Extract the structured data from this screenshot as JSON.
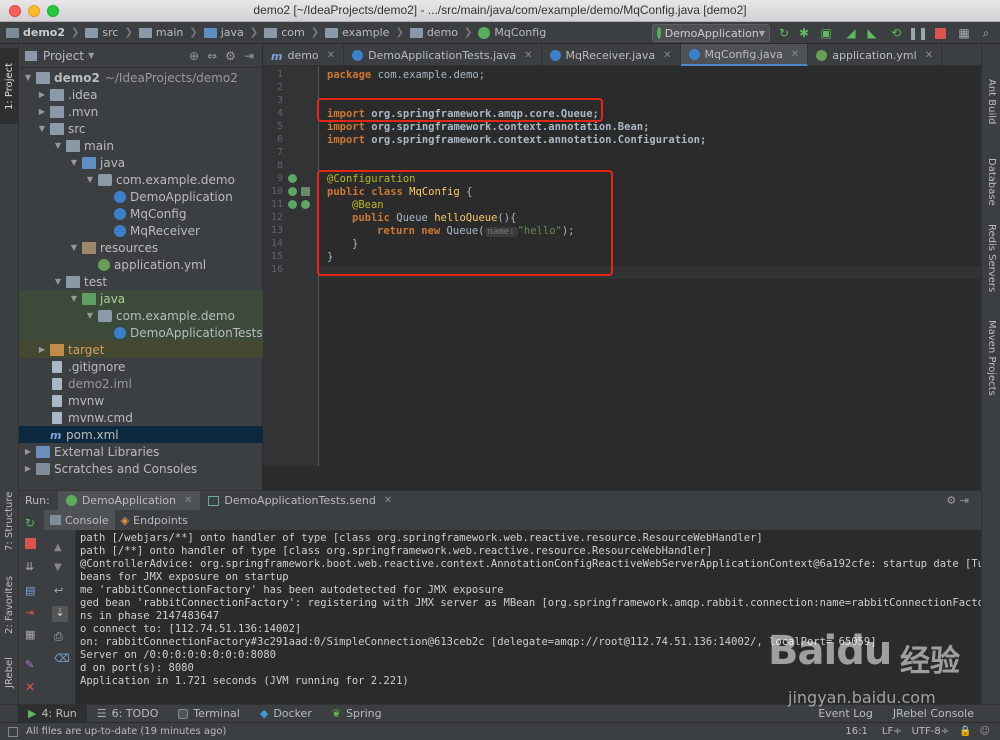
{
  "window": {
    "title": "demo2 [~/IdeaProjects/demo2] - .../src/main/java/com/example/demo/MqConfig.java [demo2]"
  },
  "navbar": {
    "breadcrumbs": [
      "demo2",
      "src",
      "main",
      "java",
      "com",
      "example",
      "demo",
      "MqConfig"
    ],
    "run_config": "DemoApplication"
  },
  "left_strip": {
    "tabs": [
      "1: Project",
      "7: Structure",
      "2: Favorites",
      "JRebel"
    ]
  },
  "right_strip": {
    "tabs": [
      "Ant Build",
      "Database",
      "Redis Servers",
      "Maven Projects"
    ]
  },
  "project": {
    "title": "Project",
    "tree": [
      {
        "label": "demo2",
        "suffix": "~/IdeaProjects/demo2",
        "icon": "folder-icon"
      },
      {
        "label": ".idea",
        "icon": "folder-icon"
      },
      {
        "label": ".mvn",
        "icon": "folder-icon"
      },
      {
        "label": "src",
        "icon": "folder-icon"
      },
      {
        "label": "main",
        "icon": "folder-icon"
      },
      {
        "label": "java",
        "icon": "source-folder-icon"
      },
      {
        "label": "com.example.demo",
        "icon": "package-icon"
      },
      {
        "label": "DemoApplication",
        "icon": "class-icon"
      },
      {
        "label": "MqConfig",
        "icon": "class-icon"
      },
      {
        "label": "MqReceiver",
        "icon": "class-icon"
      },
      {
        "label": "resources",
        "icon": "resources-folder-icon"
      },
      {
        "label": "application.yml",
        "icon": "yml-file-icon"
      },
      {
        "label": "test",
        "icon": "folder-icon"
      },
      {
        "label": "java",
        "icon": "test-folder-icon"
      },
      {
        "label": "com.example.demo",
        "icon": "package-icon"
      },
      {
        "label": "DemoApplicationTests",
        "icon": "class-icon"
      },
      {
        "label": "target",
        "icon": "excluded-folder-icon"
      },
      {
        "label": ".gitignore",
        "icon": "file-icon"
      },
      {
        "label": "demo2.iml",
        "icon": "file-icon"
      },
      {
        "label": "mvnw",
        "icon": "file-icon"
      },
      {
        "label": "mvnw.cmd",
        "icon": "file-icon"
      },
      {
        "label": "pom.xml",
        "icon": "maven-icon"
      },
      {
        "label": "External Libraries",
        "icon": "library-icon"
      },
      {
        "label": "Scratches and Consoles",
        "icon": "scratch-icon"
      }
    ]
  },
  "editor": {
    "tabs": [
      {
        "label": "demo",
        "icon": "maven-icon"
      },
      {
        "label": "DemoApplicationTests.java",
        "icon": "class-icon"
      },
      {
        "label": "MqReceiver.java",
        "icon": "class-icon"
      },
      {
        "label": "MqConfig.java",
        "icon": "class-icon",
        "active": true
      },
      {
        "label": "application.yml",
        "icon": "yml-file-icon"
      }
    ],
    "line_numbers": [
      "1",
      "2",
      "3",
      "4",
      "5",
      "6",
      "7",
      "8",
      "9",
      "10",
      "11",
      "12",
      "13",
      "14",
      "15",
      "16"
    ],
    "code": {
      "l1_kw": "package",
      "l1_rest": " com.example.demo;",
      "l4_kw": "import",
      "l4_rest": " org.springframework.amqp.core.Queue;",
      "l5_kw": "import",
      "l5_rest": " org.springframework.context.annotation.Bean;",
      "l6_kw": "import",
      "l6_rest": " org.springframework.context.annotation.Configuration;",
      "l9": "@Configuration",
      "l10_kw": "public class",
      "l10_name": " MqConfig",
      "l10_rest": " {",
      "l11": "@Bean",
      "l12_kw": "public",
      "l12_type": " Queue ",
      "l12_name": "helloQueue",
      "l12_rest": "(){",
      "l13_kw1": "return",
      "l13_kw2": " new",
      "l13_rest": " Queue(",
      "l13_hint": "name:",
      "l13_str": "\"hello\"",
      "l13_end": ");",
      "l14": "}",
      "l15": "}"
    }
  },
  "run": {
    "label": "Run:",
    "tabs": [
      "DemoApplication",
      "DemoApplicationTests.send"
    ],
    "sub_tabs": [
      "Console",
      "Endpoints"
    ],
    "console_lines": [
      "path [/webjars/**] onto handler of type [class org.springframework.web.reactive.resource.ResourceWebHandler]",
      "path [/**] onto handler of type [class org.springframework.web.reactive.resource.ResourceWebHandler]",
      "@ControllerAdvice: org.springframework.boot.web.reactive.context.AnnotationConfigReactiveWebServerApplicationContext@6a192cfe: startup date [Tue A",
      "beans for JMX exposure on startup",
      "me 'rabbitConnectionFactory' has been autodetected for JMX exposure",
      "ged bean 'rabbitConnectionFactory': registering with JMX server as MBean [org.springframework.amqp.rabbit.connection:name=rabbitConnectionFactory,t",
      "ns in phase 2147483647",
      "o connect to: [112.74.51.136:14002]",
      "on: rabbitConnectionFactory#3c291aad:0/SimpleConnection@613ceb2c [delegate=amqp://root@112.74.51.136:14002/, localPort= 65059]",
      "Server on /0:0:0:0:0:0:0:0:8080",
      "d on port(s): 8080",
      "Application in 1.721 seconds (JVM running for 2.221)"
    ]
  },
  "bottom_tabs": [
    "4: Run",
    "6: TODO",
    "Terminal",
    "Docker",
    "Spring",
    "Event Log",
    "JRebel Console"
  ],
  "status": {
    "message": "All files are up-to-date (19 minutes ago)",
    "position": "16:1",
    "line_sep": "LF÷",
    "encoding": "UTF-8÷"
  },
  "watermark": {
    "brand": "Baidu",
    "suffix": "经验",
    "url": "jingyan.baidu.com"
  },
  "colors": {
    "accent_red": "#e0271a",
    "keyword": "#cc7832",
    "annotation": "#bbb529",
    "string": "#6a8759"
  }
}
